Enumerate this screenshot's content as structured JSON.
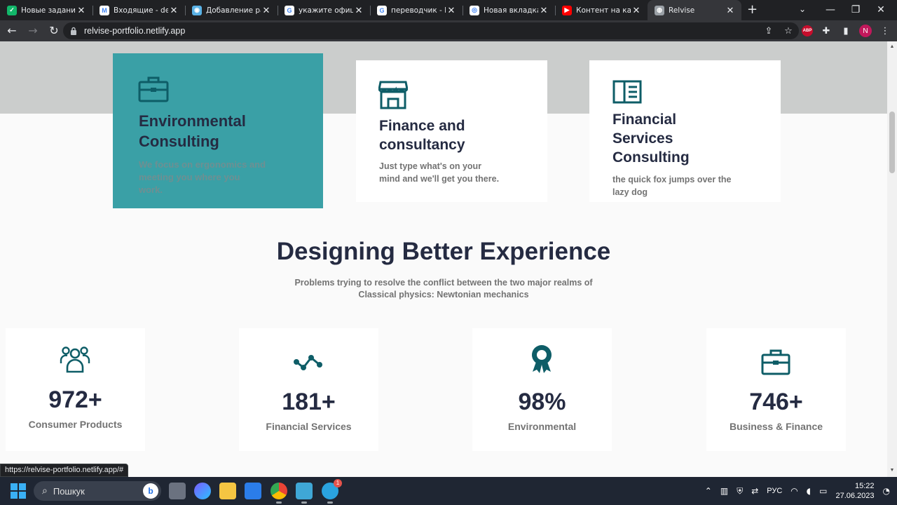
{
  "browser": {
    "tabs": [
      {
        "title": "Новые задания",
        "favicon_color": "#12b76a",
        "favicon_glyph": "✓",
        "active": false
      },
      {
        "title": "Входящие - deve",
        "favicon_color": "#ffffff",
        "favicon_glyph": "M",
        "active": false
      },
      {
        "title": "Добавление раб",
        "favicon_color": "#5ab2e6",
        "favicon_glyph": "◉",
        "active": false
      },
      {
        "title": "укажите официа",
        "favicon_color": "#ffffff",
        "favicon_glyph": "G",
        "active": false
      },
      {
        "title": "переводчик - По",
        "favicon_color": "#ffffff",
        "favicon_glyph": "G",
        "active": false
      },
      {
        "title": "Новая вкладка",
        "favicon_color": "#ffffff",
        "favicon_glyph": "◎",
        "active": false
      },
      {
        "title": "Контент на кана",
        "favicon_color": "#ff0000",
        "favicon_glyph": "▶",
        "active": false
      },
      {
        "title": "Relvise",
        "favicon_color": "#9aa0a6",
        "favicon_glyph": "◍",
        "active": true
      }
    ],
    "new_tab_icon": "plus-icon",
    "url": "relvise-portfolio.netlify.app",
    "extensions": {
      "abp": "ABP",
      "profile_initial": "N"
    },
    "status_url": "https://relvise-portfolio.netlify.app/#"
  },
  "page": {
    "cards": [
      {
        "icon": "briefcase-icon",
        "title_lines": [
          "Environmental",
          "Consulting"
        ],
        "desc_lines": [
          "We focus on ergonomics and",
          "meeting you where you",
          "work."
        ]
      },
      {
        "icon": "store-icon",
        "title_lines": [
          "Finance and",
          "consultancy"
        ],
        "desc_lines": [
          "Just type what's on your",
          "mind and we'll get you there."
        ]
      },
      {
        "icon": "book-icon",
        "title_lines": [
          "Financial",
          "Services",
          "Consulting"
        ],
        "desc_lines": [
          "the quick fox jumps over the",
          "lazy dog"
        ]
      }
    ],
    "section": {
      "title": "Designing Better Experience",
      "subtitle_lines": [
        "Problems trying to resolve the conflict between the two major realms of",
        "Classical physics: Newtonian mechanics"
      ]
    },
    "stats": [
      {
        "icon": "users-icon",
        "value": "972+",
        "label": "Consumer Products"
      },
      {
        "icon": "trend-icon",
        "value": "181+",
        "label": "Financial Services"
      },
      {
        "icon": "award-icon",
        "value": "98%",
        "label": "Environmental"
      },
      {
        "icon": "briefcase-icon",
        "value": "746+",
        "label": "Business & Finance"
      }
    ],
    "colors": {
      "accent": "#3aa0a6",
      "icon": "#0e5d67",
      "heading": "#252b42",
      "muted": "#737373"
    }
  },
  "taskbar": {
    "search_placeholder": "Пошкук",
    "language": "РУС",
    "time": "15:22",
    "date": "27.06.2023",
    "telegram_badge": "1"
  }
}
